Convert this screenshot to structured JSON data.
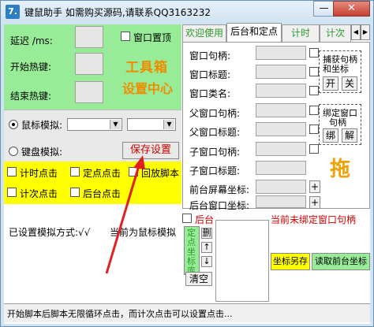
{
  "window": {
    "app_icon_glyph": "7.",
    "title": "键鼠助手  如需购买源码,请联系QQ3163232",
    "minimize_glyph": "—",
    "close_glyph": "✕"
  },
  "settings": {
    "delay_label": "延迟 /ms:",
    "start_hotkey_label": "开始热键:",
    "end_hotkey_label": "结束热键:",
    "topmost_label": "窗口置顶",
    "toolbox_line1": "工具箱",
    "toolbox_line2": "设置中心"
  },
  "mode": {
    "mouse_label": "鼠标模拟:",
    "keyboard_label": "键盘模拟:",
    "save_button": "保存设置",
    "combo_arrow": "▼"
  },
  "checks": {
    "timed_click": "计时点击",
    "fixed_click": "定点点击",
    "replay_script": "回放脚本",
    "count_click": "计次点击",
    "background_click": "后台点击"
  },
  "status": {
    "mode_status": "已设置模拟方式:√√",
    "current_mode": "当前为鼠标模拟",
    "bottom_tip": "开始脚本后脚本无限循环点击，而计次点击可以设置点击..."
  },
  "tabs": [
    {
      "label": "欢迎使用"
    },
    {
      "label": "后台和定点"
    },
    {
      "label": "计时"
    },
    {
      "label": "计次"
    }
  ],
  "tab_arrows": {
    "left": "◀",
    "right": "▶"
  },
  "window_fields": {
    "handle": "窗口句柄:",
    "title": "窗口标题:",
    "class": "窗口类名:",
    "parent_handle": "父窗口句柄:",
    "parent_title": "父窗口标题:",
    "child_handle": "子窗口句柄:",
    "child_title": "子窗口标题:",
    "front_coord": "前台屏幕坐标:",
    "back_coord": "后台窗口坐标:",
    "plus": "+"
  },
  "capture_group": {
    "title_line1": "捕获句柄",
    "title_line2": "和坐标",
    "open_button": "开",
    "close_button": "关"
  },
  "bind_group": {
    "title_line1": "绑定窗口",
    "title_line2": "句柄",
    "bind_button": "绑",
    "unbind_button": "解"
  },
  "drag_label": "拖",
  "bottom_right": {
    "background_check": "后台",
    "unbound_status": "当前未绑定窗口句柄",
    "coord_library_label": "定点坐标库",
    "delete_button": "删",
    "up_button": "↑",
    "down_button": "↓",
    "clear_button": "清空",
    "save_as_button": "坐标另存",
    "read_coord_button": "读取前台坐标"
  },
  "colors": {
    "settings_bg": "#98ec98",
    "check_panel_bg": "#ffff00",
    "accent_orange": "#f08c00",
    "red_text": "#d00000",
    "tab_green": "#2a9a2a"
  }
}
